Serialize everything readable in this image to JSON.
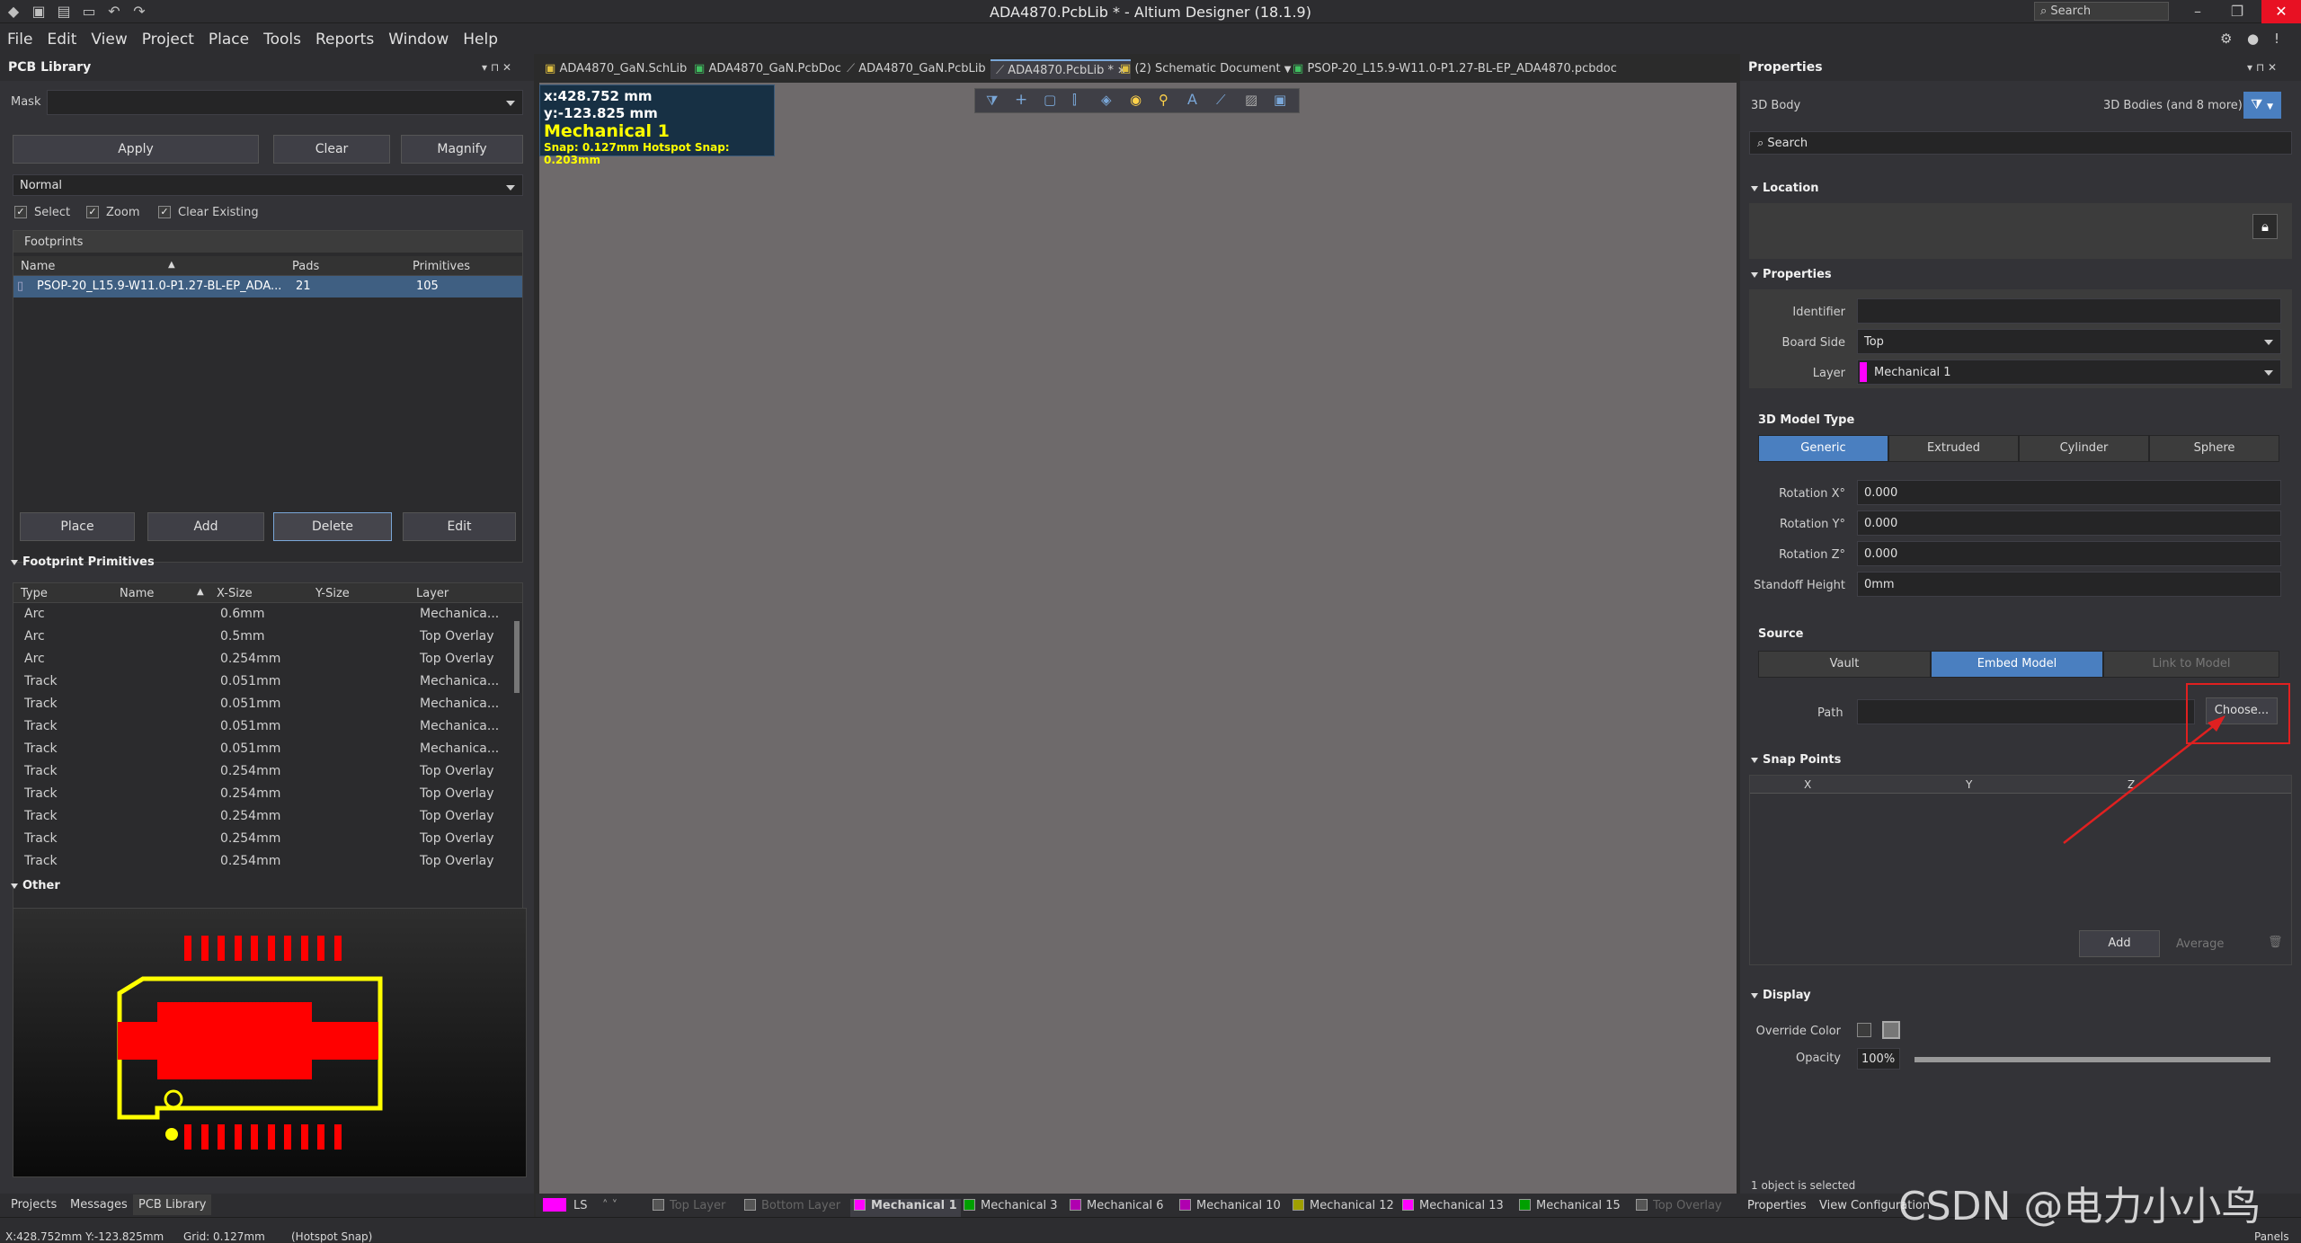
{
  "window": {
    "title": "ADA4870.PcbLib * - Altium Designer (18.1.9)",
    "search_placeholder": "Search"
  },
  "menu": [
    "File",
    "Edit",
    "View",
    "Project",
    "Place",
    "Tools",
    "Reports",
    "Window",
    "Help"
  ],
  "left_panel": {
    "title": "PCB Library",
    "mask_label": "Mask",
    "mask_value": "",
    "apply": "Apply",
    "clear": "Clear",
    "magnify": "Magnify",
    "mode": "Normal",
    "checks": [
      {
        "label": "Select",
        "checked": true
      },
      {
        "label": "Zoom",
        "checked": true
      },
      {
        "label": "Clear Existing",
        "checked": true
      }
    ],
    "footprints_label": "Footprints",
    "fp_columns": [
      "Name",
      "Pads",
      "Primitives"
    ],
    "fp_rows": [
      {
        "name": "PSOP-20_L15.9-W11.0-P1.27-BL-EP_ADA...",
        "pads": "21",
        "primitives": "105"
      }
    ],
    "place": "Place",
    "add": "Add",
    "delete": "Delete",
    "edit": "Edit",
    "primitives_title": "Footprint Primitives",
    "prim_columns": [
      "Type",
      "Name",
      "X-Size",
      "Y-Size",
      "Layer"
    ],
    "prim_rows": [
      {
        "type": "Arc",
        "name": "",
        "x": "0.6mm",
        "y": "",
        "layer": "Mechanica..."
      },
      {
        "type": "Arc",
        "name": "",
        "x": "0.5mm",
        "y": "",
        "layer": "Top Overlay"
      },
      {
        "type": "Arc",
        "name": "",
        "x": "0.254mm",
        "y": "",
        "layer": "Top Overlay"
      },
      {
        "type": "Track",
        "name": "",
        "x": "0.051mm",
        "y": "",
        "layer": "Mechanica..."
      },
      {
        "type": "Track",
        "name": "",
        "x": "0.051mm",
        "y": "",
        "layer": "Mechanica..."
      },
      {
        "type": "Track",
        "name": "",
        "x": "0.051mm",
        "y": "",
        "layer": "Mechanica..."
      },
      {
        "type": "Track",
        "name": "",
        "x": "0.051mm",
        "y": "",
        "layer": "Mechanica..."
      },
      {
        "type": "Track",
        "name": "",
        "x": "0.254mm",
        "y": "",
        "layer": "Top Overlay"
      },
      {
        "type": "Track",
        "name": "",
        "x": "0.254mm",
        "y": "",
        "layer": "Top Overlay"
      },
      {
        "type": "Track",
        "name": "",
        "x": "0.254mm",
        "y": "",
        "layer": "Top Overlay"
      },
      {
        "type": "Track",
        "name": "",
        "x": "0.254mm",
        "y": "",
        "layer": "Top Overlay"
      },
      {
        "type": "Track",
        "name": "",
        "x": "0.254mm",
        "y": "",
        "layer": "Top Overlay"
      }
    ],
    "other_title": "Other",
    "bottom_tabs": [
      "Projects",
      "Messages",
      "PCB Library"
    ]
  },
  "doc_tabs": [
    "ADA4870_GaN.SchLib",
    "ADA4870_GaN.PcbDoc",
    "ADA4870_GaN.PcbLib",
    "ADA4870.PcbLib *",
    "(2) Schematic Document",
    "PSOP-20_L15.9-W11.0-P1.27-BL-EP_ADA4870.pcbdoc"
  ],
  "hud": {
    "x": "x:428.752  mm",
    "y": "y:-123.825 mm",
    "layer": "Mechanical 1",
    "snap": "Snap: 0.127mm Hotspot Snap: 0.203mm"
  },
  "layers": {
    "ls": "LS",
    "items": [
      {
        "name": "Top Layer",
        "color": "#555555",
        "dim": true
      },
      {
        "name": "Bottom Layer",
        "color": "#555555",
        "dim": true
      },
      {
        "name": "Mechanical 1",
        "color": "#ff00ff",
        "active": true
      },
      {
        "name": "Mechanical 3",
        "color": "#00a000"
      },
      {
        "name": "Mechanical 6",
        "color": "#b000b0"
      },
      {
        "name": "Mechanical 10",
        "color": "#b000b0"
      },
      {
        "name": "Mechanical 12",
        "color": "#a0a000"
      },
      {
        "name": "Mechanical 13",
        "color": "#ff00ff"
      },
      {
        "name": "Mechanical 15",
        "color": "#00a000"
      },
      {
        "name": "Top Overlay",
        "color": "#555555",
        "dim": true
      }
    ]
  },
  "status": {
    "coords": "X:428.752mm Y:-123.825mm",
    "grid": "Grid: 0.127mm",
    "snap": "(Hotspot Snap)",
    "panels": "Panels"
  },
  "props": {
    "title": "Properties",
    "object": "3D Body",
    "filter": "3D Bodies (and 8 more)",
    "search_placeholder": "Search",
    "location": "Location",
    "properties": "Properties",
    "identifier_label": "Identifier",
    "identifier": "",
    "board_side_label": "Board Side",
    "board_side": "Top",
    "layer_label": "Layer",
    "layer": "Mechanical 1",
    "model_type_label": "3D Model Type",
    "model_types": [
      "Generic",
      "Extruded",
      "Cylinder",
      "Sphere"
    ],
    "rot_x_label": "Rotation X°",
    "rot_x": "0.000",
    "rot_y_label": "Rotation Y°",
    "rot_y": "0.000",
    "rot_z_label": "Rotation Z°",
    "rot_z": "0.000",
    "standoff_label": "Standoff Height",
    "standoff": "0mm",
    "source_label": "Source",
    "sources": [
      "Vault",
      "Embed Model",
      "Link to Model"
    ],
    "path_label": "Path",
    "choose": "Choose...",
    "snap_points": "Snap Points",
    "snap_cols": [
      "X",
      "Y",
      "Z"
    ],
    "add": "Add",
    "average": "Average",
    "display": "Display",
    "override_label": "Override Color",
    "opacity_label": "Opacity",
    "opacity": "100%",
    "selected": "1 object is selected",
    "bottom_tabs": [
      "Properties",
      "View Configuration"
    ]
  },
  "watermark": "CSDN @电力小小鸟"
}
